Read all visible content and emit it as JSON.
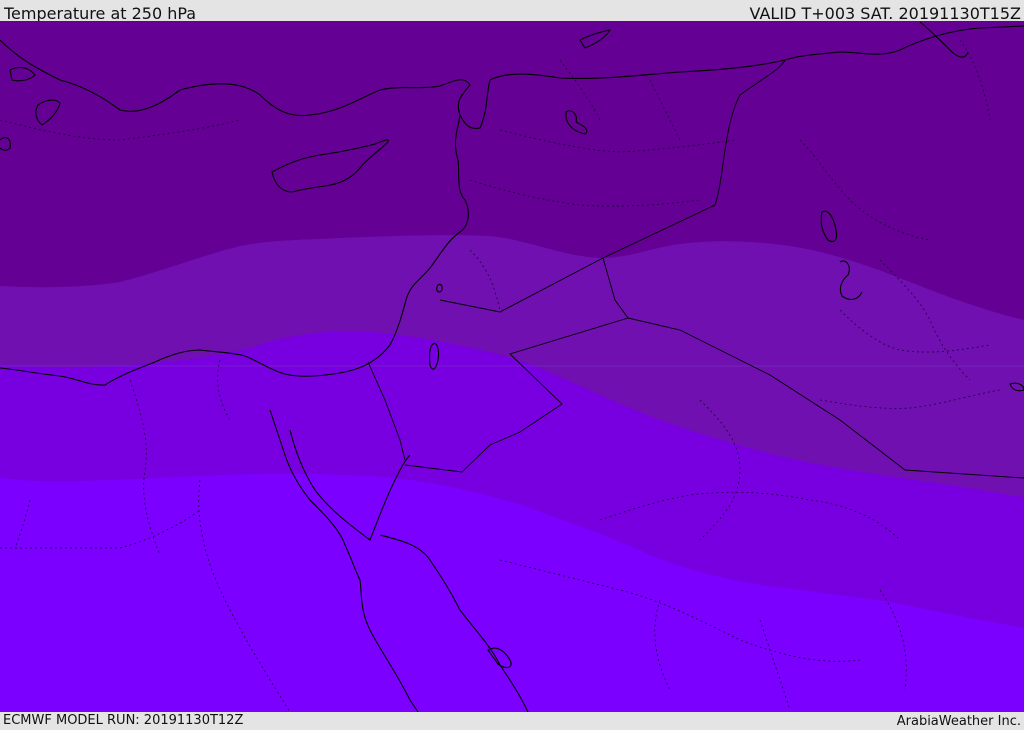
{
  "header": {
    "title": "Temperature at 250 hPa",
    "valid_time": "VALID T+003 SAT. 20191130T15Z"
  },
  "footer": {
    "model_run": "ECMWF MODEL RUN: 20191130T12Z",
    "credit": "ArabiaWeather Inc."
  },
  "map": {
    "type": "temperature field map",
    "bands": [
      {
        "color": "#640093"
      },
      {
        "color": "#7010b0"
      },
      {
        "color": "#7800e0"
      },
      {
        "color": "#7b00ff"
      }
    ],
    "coastline_color": "#000000",
    "border_style": "dotted"
  }
}
